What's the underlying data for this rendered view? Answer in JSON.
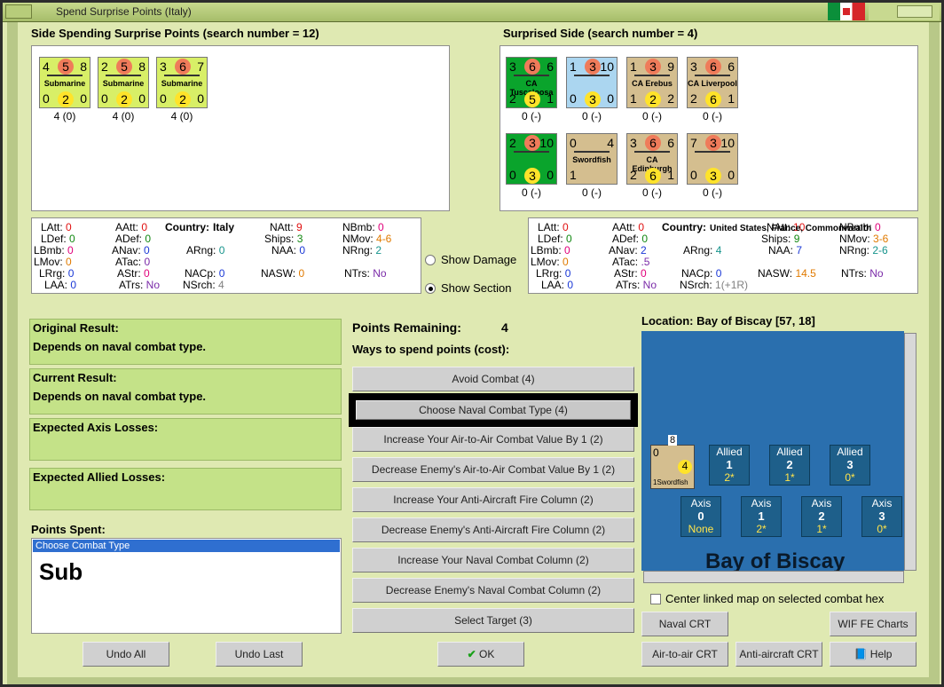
{
  "window": {
    "title": "Spend Surprise Points (Italy)"
  },
  "left_side": {
    "header": "Side Spending Surprise Points (search number = 12)",
    "units": [
      {
        "top": "4",
        "circle": "5",
        "right": "8",
        "name": "Submarine",
        "b1": "0",
        "b2": "2",
        "b3": "0",
        "caption": "4 (0)"
      },
      {
        "top": "2",
        "circle": "5",
        "right": "8",
        "name": "Submarine",
        "b1": "0",
        "b2": "2",
        "b3": "0",
        "caption": "4 (0)"
      },
      {
        "top": "3",
        "circle": "6",
        "right": "7",
        "name": "Submarine",
        "b1": "0",
        "b2": "2",
        "b3": "0",
        "caption": "4 (0)"
      }
    ]
  },
  "right_side": {
    "header": "Surprised Side (search number = 4)",
    "units": [
      {
        "top": "3",
        "circle": "6",
        "right": "6",
        "name": "CA Tuscaloosa",
        "b1": "2",
        "b2": "5",
        "b3": "1",
        "caption": "0 (-)"
      },
      {
        "top": "1",
        "circle": "3",
        "right": "10",
        "name": "",
        "b1": "0",
        "b2": "3",
        "b3": "0",
        "caption": "0 (-)"
      },
      {
        "top": "1",
        "circle": "3",
        "right": "9",
        "name": "CA Erebus",
        "b1": "1",
        "b2": "2",
        "b3": "2",
        "caption": "0 (-)"
      },
      {
        "top": "3",
        "circle": "6",
        "right": "6",
        "name": "CA Liverpool",
        "b1": "2",
        "b2": "6",
        "b3": "1",
        "caption": "0 (-)"
      },
      {
        "top": "2",
        "circle": "3",
        "right": "10",
        "name": "",
        "b1": "0",
        "b2": "3",
        "b3": "0",
        "caption": "0 (-)"
      },
      {
        "top": "0",
        "circle": "",
        "right": "4",
        "name": "Swordfish",
        "b1": "1",
        "b2": "",
        "b3": "",
        "caption": "0 (-)"
      },
      {
        "top": "3",
        "circle": "6",
        "right": "6",
        "name": "CA Edinburgh",
        "b1": "2",
        "b2": "6",
        "b3": "1",
        "caption": "0 (-)"
      },
      {
        "top": "7",
        "circle": "3",
        "right": "10",
        "name": "",
        "b1": "0",
        "b2": "3",
        "b3": "0",
        "caption": "0 (-)"
      }
    ]
  },
  "left_stats": {
    "country_label": "Country:",
    "country": "Italy",
    "LAtt": "0",
    "AAtt": "0",
    "NAtt": "9",
    "NBmb": "0",
    "LDef": "0",
    "ADef": "0",
    "Ships": "3",
    "NMov": "4-6",
    "LBmb": "0",
    "ANav": "0",
    "ARng": "0",
    "NAA": "0",
    "NRng": "2",
    "LMov": "0",
    "ATac": "0",
    "LRrg": "0",
    "AStr": "0",
    "NACp": "0",
    "NASW": "0",
    "NTrs": "No",
    "LAA": "0",
    "ATrs": "No",
    "NSrch": "4"
  },
  "right_stats": {
    "country_label": "Country:",
    "country": "United States, France, Commonwealth",
    "LAtt": "0",
    "AAtt": "0",
    "NAtt": "10",
    "NBmb": "0",
    "LDef": "0",
    "ADef": "0",
    "Ships": "9",
    "NMov": "3-6",
    "LBmb": "0",
    "ANav": "2",
    "ARng": "4",
    "NAA": "7",
    "NRng": "2-6",
    "LMov": "0",
    "ATac": ".5",
    "LRrg": "0",
    "AStr": "0",
    "NACp": "0",
    "NASW": "14.5",
    "NTrs": "No",
    "LAA": "0",
    "ATrs": "No",
    "NSrch": "1(+1R)"
  },
  "radios": {
    "show_damage": "Show Damage",
    "show_section": "Show Section"
  },
  "results": {
    "original_label": "Original Result:",
    "original_value": "Depends on naval combat type.",
    "current_label": "Current Result:",
    "current_value": "Depends on naval combat type.",
    "axis_losses_label": "Expected Axis Losses:",
    "allied_losses_label": "Expected Allied Losses:",
    "points_spent_label": "Points Spent:",
    "points_spent_item": "Choose Combat Type",
    "points_spent_big": "Sub"
  },
  "spend": {
    "points_remaining_label": "Points Remaining:",
    "points_remaining": "4",
    "ways_label": "Ways to spend points (cost):",
    "options": [
      "Avoid Combat (4)",
      "Choose Naval Combat Type (4)",
      "Increase Your Air-to-Air Combat Value By 1 (2)",
      "Decrease Enemy's Air-to-Air Combat Value By 1 (2)",
      "Increase Your Anti-Aircraft Fire Column (2)",
      "Decrease Enemy's Anti-Aircraft Fire Column (2)",
      "Increase Your Naval Combat Column (2)",
      "Decrease Enemy's Naval Combat Column (2)",
      "Select Target (3)"
    ]
  },
  "map": {
    "location": "Location: Bay of Biscay [57, 18]",
    "stack_count": "8",
    "unit_name": "Swordfish",
    "unit_top": "0",
    "unit_right": "4",
    "unit_bottom": "1",
    "allied_boxes": [
      {
        "label": "Allied",
        "num": "1",
        "val": "2*"
      },
      {
        "label": "Allied",
        "num": "2",
        "val": "1*"
      },
      {
        "label": "Allied",
        "num": "3",
        "val": "0*"
      }
    ],
    "axis_boxes": [
      {
        "label": "Axis",
        "num": "0",
        "val": "None"
      },
      {
        "label": "Axis",
        "num": "1",
        "val": "2*"
      },
      {
        "label": "Axis",
        "num": "2",
        "val": "1*"
      },
      {
        "label": "Axis",
        "num": "3",
        "val": "0*"
      }
    ],
    "sea_name": "Bay of Biscay",
    "center_label": "Center linked map on selected combat hex"
  },
  "buttons": {
    "undo_all": "Undo All",
    "undo_last": "Undo Last",
    "ok": "OK",
    "naval_crt": "Naval CRT",
    "wif_charts": "WIF FE Charts",
    "air_crt": "Air-to-air CRT",
    "aa_crt": "Anti-aircraft CRT",
    "help": "Help"
  }
}
